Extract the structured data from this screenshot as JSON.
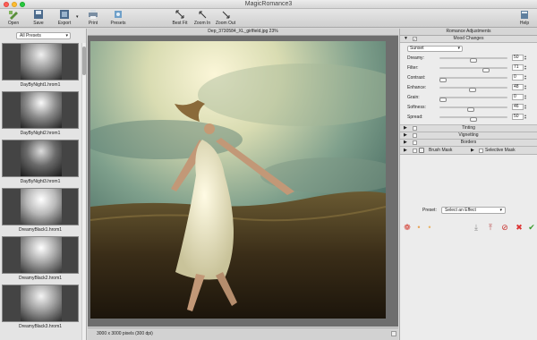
{
  "window": {
    "title": "MagicRomance3"
  },
  "toolbar": {
    "open": "Open",
    "save": "Save",
    "export": "Export",
    "print": "Print",
    "presets": "Presets",
    "best_fit": "Best Fit",
    "zoom_in": "Zoom In",
    "zoom_out": "Zoom Out",
    "help": "Help"
  },
  "sidebar": {
    "preset_group": "All Presets",
    "items": [
      {
        "label": "DayByNight1.hrom1"
      },
      {
        "label": "DayByNight2.hrom1"
      },
      {
        "label": "DayByNight3.hrom1"
      },
      {
        "label": "DreamyBlack1.hrom1"
      },
      {
        "label": "DreamyBlack2.hrom1"
      },
      {
        "label": "DreamyBlack3.hrom1"
      }
    ]
  },
  "document": {
    "title": "Dep_3730584_XL_girlfield.jpg 23%",
    "status": "3000 x 3000 pixels (300 dpi)"
  },
  "panel": {
    "title": "Romance Adjustments",
    "mood": {
      "label": "Mood Changes",
      "check": "✓",
      "preset": "Sunset",
      "sliders": [
        {
          "label": "Dreamy:",
          "value": "50",
          "fill": 0.5
        },
        {
          "label": "Filter:",
          "value": "71",
          "fill": 0.71
        },
        {
          "label": "Contrast:",
          "value": "0",
          "fill": 0.0
        },
        {
          "label": "Enhance:",
          "value": "48",
          "fill": 0.48
        },
        {
          "label": "Grain:",
          "value": "0",
          "fill": 0.0
        },
        {
          "label": "Softness:",
          "value": "46",
          "fill": 0.46
        },
        {
          "label": "Spread:",
          "value": "50",
          "fill": 0.5
        }
      ]
    },
    "sections": [
      {
        "label": "Tinting"
      },
      {
        "label": "Vignetting"
      },
      {
        "label": "Borders"
      }
    ],
    "brush_mask": "Brush Mask",
    "selective_mask": "Selective Mask",
    "preset_label": "Preset:",
    "preset_value": "Select an Effect"
  }
}
